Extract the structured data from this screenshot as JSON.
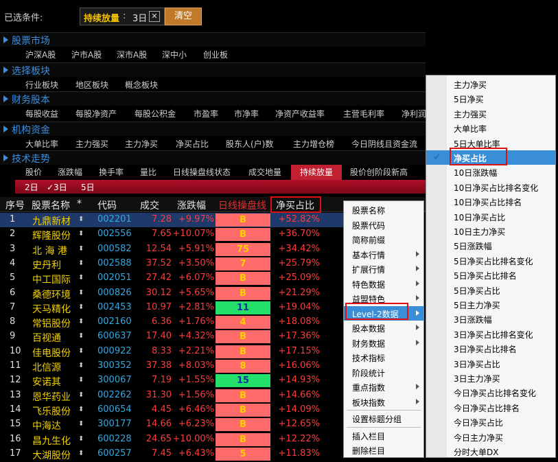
{
  "condition_bar": {
    "label": "已选条件:",
    "tag_name": "持续放量",
    "tag_sep": ":",
    "tag_value": "3日",
    "tag_close": "✕",
    "clear_button": "清空"
  },
  "sections": [
    {
      "title": "股票市场",
      "items": [
        "沪深A股",
        "沪市A股",
        "深市A股",
        "深中小",
        "创业板"
      ]
    },
    {
      "title": "选择板块",
      "items": [
        "行业板块",
        "地区板块",
        "概念板块"
      ]
    },
    {
      "title": "财务股本",
      "items": [
        "每股收益",
        "每股净资产",
        "每股公积金",
        "市盈率",
        "市净率",
        "净资产收益率",
        "主营毛利率",
        "净利润"
      ]
    },
    {
      "title": "机构资金",
      "items": [
        "大单比率",
        "主力强买",
        "主力净买",
        "净买占比",
        "股东人(户)数",
        "主力增仓榜",
        "今日阴线且资金流"
      ]
    },
    {
      "title": "技术走势",
      "items": []
    }
  ],
  "trend_tabs": [
    "股价",
    "涨跌幅",
    "换手率",
    "量比",
    "日线操盘线状态",
    "成交地量",
    "持续放量",
    "股价创阶段新高"
  ],
  "active_tab": "持续放量",
  "sub_options": [
    "2日",
    "✓3日",
    "5日"
  ],
  "table": {
    "headers": [
      "序号",
      "股票名称",
      "*",
      "代码",
      "成交",
      "涨跌幅",
      "日线操盘线",
      "净买占比"
    ],
    "rows": [
      {
        "idx": "1",
        "name": "九鼎新材",
        "code": "002201",
        "price": "7.28",
        "chg": "+9.97%",
        "signal": "B",
        "ratio": "+52.82%"
      },
      {
        "idx": "2",
        "name": "辉隆股份",
        "code": "002556",
        "price": "7.65",
        "chg": "+10.07%",
        "signal": "B",
        "ratio": "+36.70%"
      },
      {
        "idx": "3",
        "name": "北 海 港",
        "code": "000582",
        "price": "12.54",
        "chg": "+5.91%",
        "signal": "75",
        "ratio": "+34.42%"
      },
      {
        "idx": "4",
        "name": "史丹利",
        "code": "002588",
        "price": "37.52",
        "chg": "+3.50%",
        "signal": "7",
        "ratio": "+25.79%"
      },
      {
        "idx": "5",
        "name": "中工国际",
        "code": "002051",
        "price": "27.42",
        "chg": "+6.07%",
        "signal": "B",
        "ratio": "+25.09%"
      },
      {
        "idx": "6",
        "name": "桑德环境",
        "code": "000826",
        "price": "30.12",
        "chg": "+5.65%",
        "signal": "B",
        "ratio": "+21.29%"
      },
      {
        "idx": "7",
        "name": "天马精化",
        "code": "002453",
        "price": "10.97",
        "chg": "+2.81%",
        "signal": "11",
        "ratio": "+19.04%"
      },
      {
        "idx": "8",
        "name": "常铝股份",
        "code": "002160",
        "price": "6.36",
        "chg": "+1.76%",
        "signal": "4",
        "ratio": "+18.08%"
      },
      {
        "idx": "9",
        "name": "百视通",
        "code": "600637",
        "price": "17.40",
        "chg": "+4.32%",
        "signal": "B",
        "ratio": "+17.36%"
      },
      {
        "idx": "10",
        "name": "佳电股份",
        "code": "000922",
        "price": "8.33",
        "chg": "+2.21%",
        "signal": "B",
        "ratio": "+17.15%"
      },
      {
        "idx": "11",
        "name": "北信源",
        "code": "300352",
        "price": "37.38",
        "chg": "+8.03%",
        "signal": "8",
        "ratio": "+16.06%"
      },
      {
        "idx": "12",
        "name": "安诺其",
        "code": "300067",
        "price": "7.19",
        "chg": "+1.55%",
        "signal": "15",
        "ratio": "+14.93%"
      },
      {
        "idx": "13",
        "name": "恩华药业",
        "code": "002262",
        "price": "31.30",
        "chg": "+1.56%",
        "signal": "B",
        "ratio": "+14.66%"
      },
      {
        "idx": "14",
        "name": "飞乐股份",
        "code": "600654",
        "price": "4.45",
        "chg": "+6.46%",
        "signal": "B",
        "ratio": "+14.09%"
      },
      {
        "idx": "15",
        "name": "中海达",
        "code": "300177",
        "price": "14.66",
        "chg": "+6.23%",
        "signal": "B",
        "ratio": "+12.65%"
      },
      {
        "idx": "16",
        "name": "昌九生化",
        "code": "600228",
        "price": "24.65",
        "chg": "+10.00%",
        "signal": "B",
        "ratio": "+12.22%"
      },
      {
        "idx": "17",
        "name": "大湖股份",
        "code": "600257",
        "price": "7.45",
        "chg": "+6.43%",
        "signal": "5",
        "ratio": "+11.83%"
      }
    ]
  },
  "signal_colors": {
    "red": "#ff6b6b",
    "green": "#22e06a",
    "orange_text": "#ffd000",
    "blue_text": "#1030a0"
  },
  "context_menu": [
    {
      "label": "股票名称",
      "arrow": false
    },
    {
      "label": "股票代码",
      "arrow": false
    },
    {
      "label": "简称前缀",
      "arrow": false
    },
    {
      "label": "基本行情",
      "arrow": true
    },
    {
      "label": "扩展行情",
      "arrow": true
    },
    {
      "label": "特色数据",
      "arrow": true
    },
    {
      "label": "益盟特色",
      "arrow": true
    },
    {
      "label": "Level-2数据",
      "arrow": true,
      "active": true
    },
    {
      "label": "股本数据",
      "arrow": true
    },
    {
      "label": "财务数据",
      "arrow": true
    },
    {
      "label": "技术指标",
      "arrow": false
    },
    {
      "label": "阶段统计",
      "arrow": false
    },
    {
      "label": "重点指数",
      "arrow": true
    },
    {
      "label": "板块指数",
      "arrow": true
    },
    {
      "label": "设置标题分组",
      "arrow": false
    },
    {
      "label": "插入栏目",
      "arrow": false
    },
    {
      "label": "删除栏目",
      "arrow": false
    }
  ],
  "submenu": [
    "主力净买",
    "5日净买",
    "主力强买",
    "大单比率",
    "5日大单比率",
    "净买占比",
    "10日涨跌幅",
    "10日净买占比排名变化",
    "10日净买占比排名",
    "10日净买占比",
    "10日主力净买",
    "5日涨跌幅",
    "5日净买占比排名变化",
    "5日净买占比排名",
    "5日净买占比",
    "5日主力净买",
    "3日涨跌幅",
    "3日净买占比排名变化",
    "3日净买占比排名",
    "3日净买占比",
    "3日主力净买",
    "今日净买占比排名变化",
    "今日净买占比排名",
    "今日净买占比",
    "今日主力净买",
    "分时大单DX"
  ],
  "submenu_checked": "净买占比"
}
